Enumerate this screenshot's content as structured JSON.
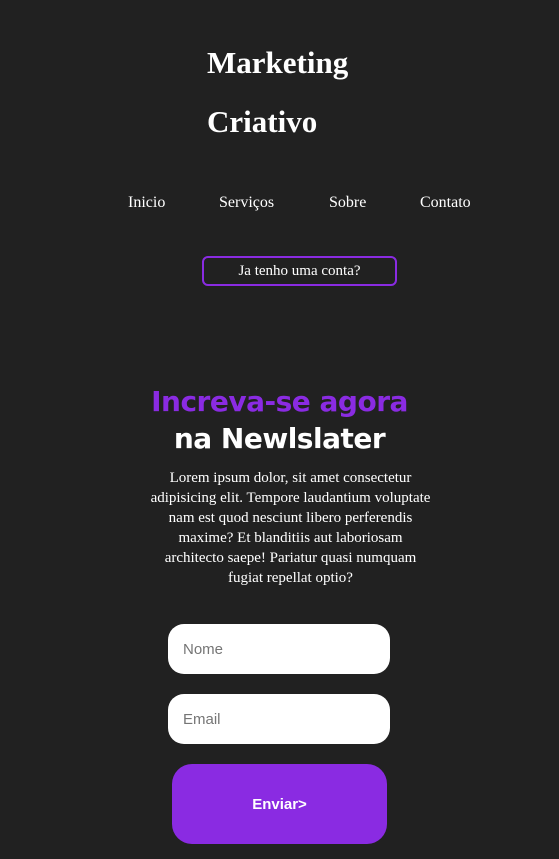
{
  "brand": {
    "line1": "Marketing",
    "line2": "Criativo"
  },
  "nav": {
    "items": [
      {
        "label": "Inicio"
      },
      {
        "label": "Serviços"
      },
      {
        "label": "Sobre"
      },
      {
        "label": "Contato"
      }
    ]
  },
  "account_button": {
    "label": "Ja tenho uma conta?"
  },
  "newsletter": {
    "headline_accent": "Increva-se agora",
    "headline_main": "na Newlslater",
    "description": "Lorem ipsum dolor, sit amet consectetur adipisicing elit. Tempore laudantium voluptate nam est quod nesciunt libero perferendis maxime? Et blanditiis aut laboriosam architecto saepe! Pariatur quasi numquam fugiat repellat optio?",
    "name_placeholder": "Nome",
    "email_placeholder": "Email",
    "submit_label": "Enviar>"
  },
  "colors": {
    "background": "#212121",
    "accent": "#8a2be2",
    "text": "#ffffff",
    "input_background": "#ffffff"
  }
}
